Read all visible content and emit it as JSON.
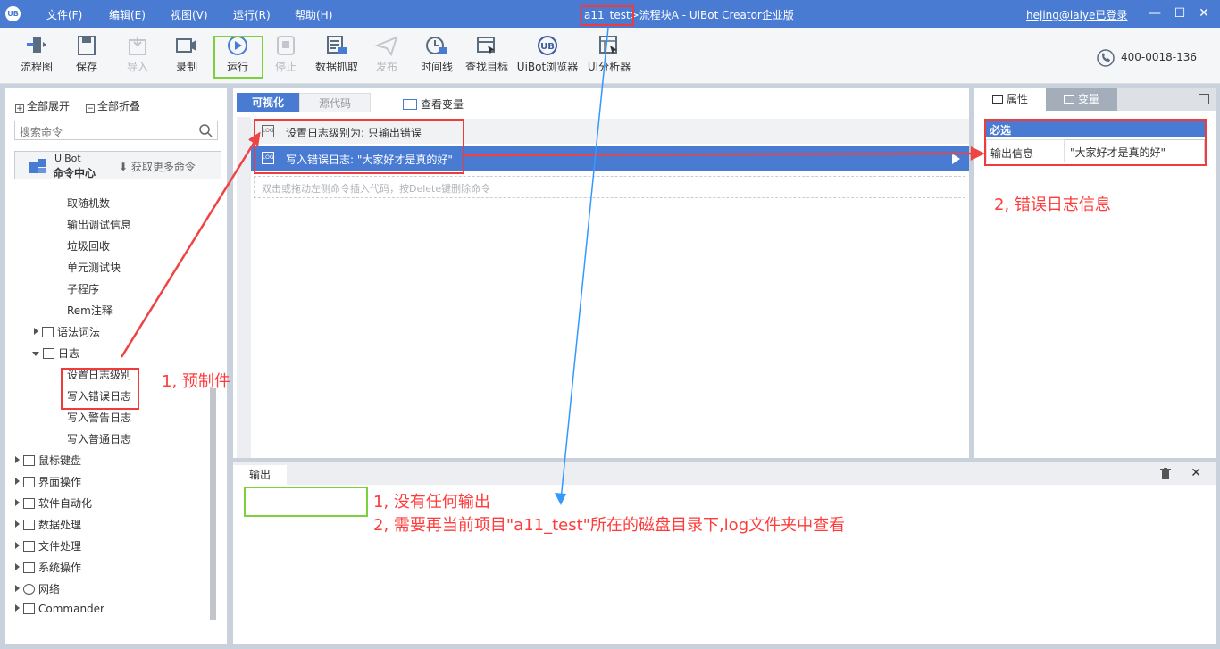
{
  "titlebar": {
    "menus": [
      "文件(F)",
      "编辑(E)",
      "视图(V)",
      "运行(R)",
      "帮助(H)"
    ],
    "window_title": "a11_test>流程块A - UiBot Creator企业版",
    "user": "hejing@laiye已登录",
    "logo_text": "UB"
  },
  "toolbar": {
    "buttons": [
      {
        "label": "流程图",
        "icon": "flowchart-icon",
        "enabled": true
      },
      {
        "label": "保存",
        "icon": "save-icon",
        "enabled": true
      },
      {
        "label": "导入",
        "icon": "import-icon",
        "enabled": false
      },
      {
        "label": "录制",
        "icon": "record-icon",
        "enabled": true
      },
      {
        "label": "运行",
        "icon": "run-icon",
        "enabled": true
      },
      {
        "label": "停止",
        "icon": "stop-icon",
        "enabled": false
      },
      {
        "label": "数据抓取",
        "icon": "data-scrape-icon",
        "enabled": true
      },
      {
        "label": "发布",
        "icon": "publish-icon",
        "enabled": false
      },
      {
        "label": "时间线",
        "icon": "timeline-icon",
        "enabled": true
      },
      {
        "label": "查找目标",
        "icon": "find-target-icon",
        "enabled": true
      },
      {
        "label": "UiBot浏览器",
        "icon": "uibot-browser-icon",
        "enabled": true
      },
      {
        "label": "UI分析器",
        "icon": "ui-analyzer-icon",
        "enabled": true
      }
    ],
    "phone": "400-0018-136"
  },
  "left": {
    "expand_all": "全部展开",
    "collapse_all": "全部折叠",
    "search_placeholder": "搜索命令",
    "cmd_center_line1": "UiBot",
    "cmd_center_line2": "命令中心",
    "get_more": "获取更多命令",
    "tree": [
      {
        "label": "取随机数",
        "level": 2
      },
      {
        "label": "输出调试信息",
        "level": 2
      },
      {
        "label": "垃圾回收",
        "level": 2
      },
      {
        "label": "单元测试块",
        "level": 2
      },
      {
        "label": "子程序",
        "level": 2
      },
      {
        "label": "Rem注释",
        "level": 2
      },
      {
        "label": "语法词法",
        "level": 1,
        "expanded": false
      },
      {
        "label": "日志",
        "level": 1,
        "expanded": true
      },
      {
        "label": "设置日志级别",
        "level": 2
      },
      {
        "label": "写入错误日志",
        "level": 2
      },
      {
        "label": "写入警告日志",
        "level": 2
      },
      {
        "label": "写入普通日志",
        "level": 2
      },
      {
        "label": "鼠标键盘",
        "level": 0
      },
      {
        "label": "界面操作",
        "level": 0
      },
      {
        "label": "软件自动化",
        "level": 0
      },
      {
        "label": "数据处理",
        "level": 0
      },
      {
        "label": "文件处理",
        "level": 0
      },
      {
        "label": "系统操作",
        "level": 0
      },
      {
        "label": "网络",
        "level": 0
      },
      {
        "label": "Commander",
        "level": 0
      }
    ]
  },
  "center": {
    "tab_visual": "可视化",
    "tab_source": "源代码",
    "view_vars": "查看变量",
    "rows": [
      {
        "icon": "LOG",
        "text": "设置日志级别为: 只输出错误"
      },
      {
        "icon": "LOG",
        "text": "写入错误日志: \"大家好才是真的好\""
      }
    ],
    "hint": "双击或拖动左侧命令插入代码，按Delete键删除命令"
  },
  "right": {
    "tab_props": "属性",
    "tab_vars": "变量",
    "required": "必选",
    "prop_label": "输出信息",
    "prop_value": "\"大家好才是真的好\""
  },
  "output": {
    "tab": "输出"
  },
  "annotations": {
    "a1": "1, 预制件",
    "a2": "2, 错误日志信息",
    "a3": "1, 没有任何输出",
    "a4": "2, 需要再当前项目\"a11_test\"所在的磁盘目录下,log文件夹中查看"
  },
  "colors": {
    "accent": "#4a7bd3",
    "annotation_red": "#ef3b3b",
    "annotation_green": "#7cd13b",
    "annotation_blue": "#3399ff"
  }
}
